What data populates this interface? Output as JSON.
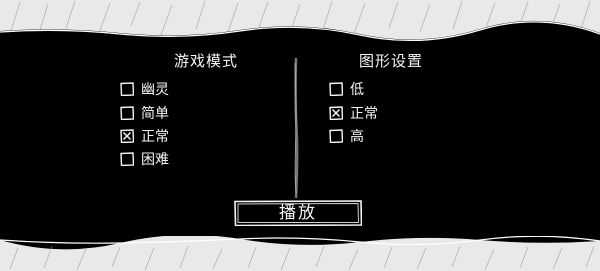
{
  "game_mode": {
    "title": "游戏模式",
    "options": [
      {
        "label": "幽灵",
        "checked": false
      },
      {
        "label": "简单",
        "checked": false
      },
      {
        "label": "正常",
        "checked": true
      },
      {
        "label": "困难",
        "checked": false
      }
    ]
  },
  "graphics": {
    "title": "图形设置",
    "options": [
      {
        "label": "低",
        "checked": false
      },
      {
        "label": "正常",
        "checked": true
      },
      {
        "label": "高",
        "checked": false
      }
    ]
  },
  "play_button": {
    "label": "播放"
  },
  "colors": {
    "background": "#000000",
    "band": "#e9e9e9",
    "text": "#f5f5f5"
  }
}
